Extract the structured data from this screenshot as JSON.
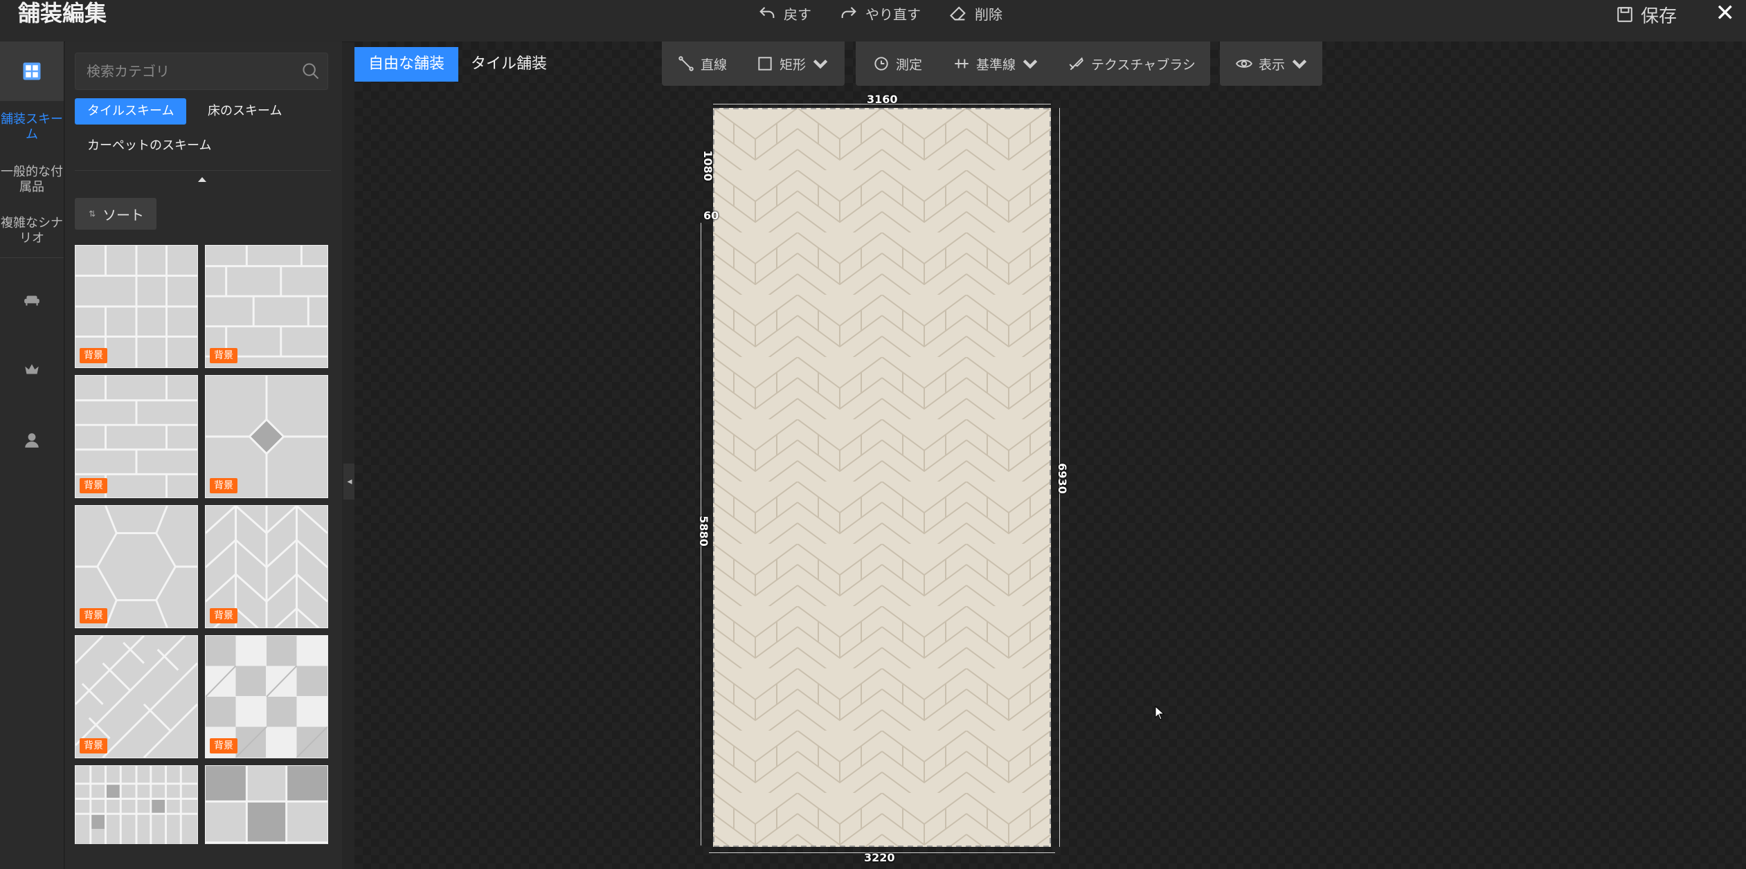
{
  "window": {
    "title": "舗装編集",
    "undo_label": "戻す",
    "redo_label": "やり直す",
    "delete_label": "削除",
    "save_label": "保存",
    "close_glyph": "✕"
  },
  "rail": {
    "items": [
      {
        "label": "舗装スキーム",
        "active": true
      },
      {
        "label": "一般的な付属品"
      },
      {
        "label": "複雑なシナリオ"
      }
    ],
    "icons": [
      "sofa-icon",
      "crown-icon",
      "user-icon"
    ]
  },
  "panel": {
    "search_placeholder": "検索カテゴリ",
    "chips": [
      "タイルスキーム",
      "床のスキーム",
      "カーペットのスキーム"
    ],
    "sort_label": "ソート",
    "badge_label": "背景"
  },
  "canvas": {
    "mode_tabs": [
      "自由な舗装",
      "タイル舗装"
    ],
    "tools": {
      "line": "直線",
      "rect": "矩形",
      "measure": "測定",
      "guide": "基準線",
      "texture_brush": "テクスチャブラシ",
      "display": "表示"
    },
    "dims": {
      "top": "3160",
      "bottom": "3220",
      "left_main": "5880",
      "left_small": "1080",
      "left_offset": "60",
      "right": "6930"
    }
  },
  "colors": {
    "accent": "#2f8bff",
    "badge": "#ff6a13",
    "background": "#262626"
  }
}
